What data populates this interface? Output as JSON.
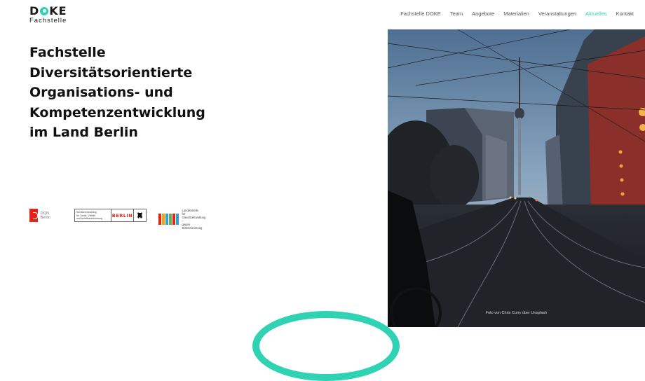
{
  "brand": {
    "name_prefix": "D",
    "name_suffix": "KE",
    "subtitle": "Fachstelle",
    "accent_color": "#2fd3b4"
  },
  "nav": {
    "items": [
      {
        "label": "Fachstelle DOKE",
        "active": false
      },
      {
        "label": "Team",
        "active": false
      },
      {
        "label": "Angebote",
        "active": false
      },
      {
        "label": "Materialien",
        "active": false
      },
      {
        "label": "Veranstaltungen",
        "active": false
      },
      {
        "label": "Aktuelles",
        "active": true
      },
      {
        "label": "Kontakt",
        "active": false
      }
    ]
  },
  "hero": {
    "title_lines": [
      "Fachstelle",
      "Diversitätsorientierte",
      "Organisations- und",
      "Kompetenzentwicklung",
      "im Land Berlin"
    ]
  },
  "partners": {
    "dqn": {
      "name": "DQN Berlin",
      "icon": "dqn-logo-icon"
    },
    "senat": {
      "text_lines": [
        "Senatsverwaltung",
        "für Justiz, Vielfalt",
        "und Antidiskriminierung"
      ],
      "wordmark": "BERLIN",
      "icon": "berlin-bear-icon"
    },
    "lads": {
      "text_lines": [
        "Landesstelle",
        "für Gleichbehandlung –",
        "gegen Diskriminierung"
      ],
      "bar_colors": [
        "#e2231a",
        "#f4a300",
        "#2fa0d8",
        "#6ab04c",
        "#e2231a",
        "#2fa0d8"
      ]
    }
  },
  "photo": {
    "credit": "Foto von Chris Curry über Unsplash"
  }
}
